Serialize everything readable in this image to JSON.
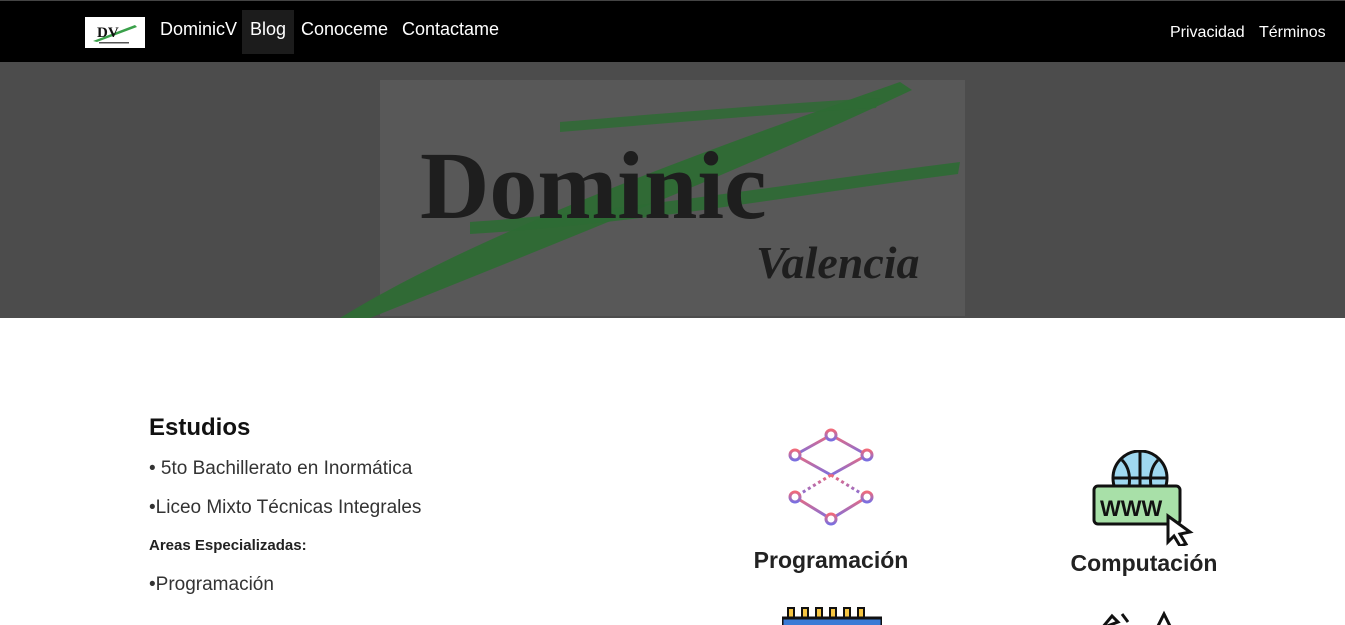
{
  "nav": {
    "brand": "DominicV",
    "logo_text": "DV",
    "links": [
      "Blog",
      "Conoceme",
      "Contactame"
    ],
    "right_links": [
      "Privacidad",
      "Términos"
    ]
  },
  "hero": {
    "title": "Dominic",
    "subtitle": "Valencia"
  },
  "studies": {
    "title": "Estudios",
    "items": [
      "• 5to Bachillerato en Inormática",
      "•Liceo Mixto Técnicas Integrales"
    ],
    "areas_title": "Areas Especializadas:",
    "areas": [
      "•Programación"
    ]
  },
  "cards": [
    {
      "label": "Programación",
      "icon": "cube-network-icon"
    },
    {
      "label": "Computación",
      "icon": "www-globe-icon"
    }
  ],
  "colors": {
    "navbar": "#000000",
    "hero_bg": "#4c4c4c",
    "accent_green": "#2e7d3a"
  }
}
